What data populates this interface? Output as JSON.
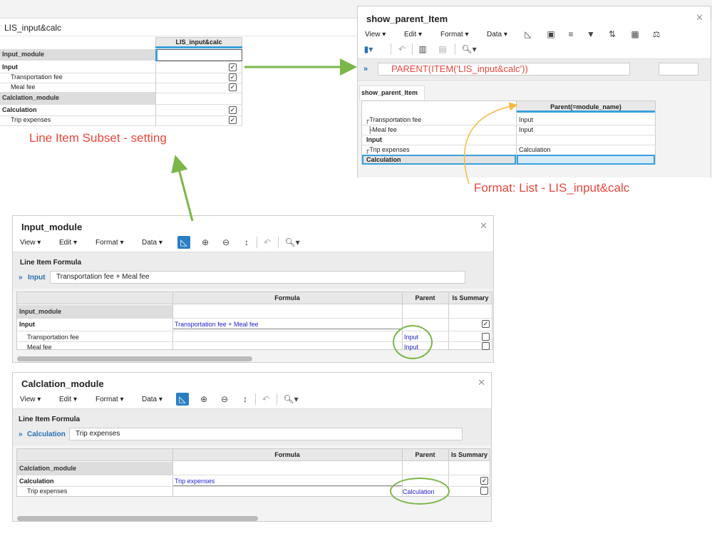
{
  "lis_view": {
    "title": "LIS_input&calc",
    "column_header": "LIS_input&calc",
    "rows": [
      {
        "label": "Input_module"
      },
      {
        "label": "Input"
      },
      {
        "label": "Transportation fee"
      },
      {
        "label": "Meal fee"
      },
      {
        "label": "Calclation_module"
      },
      {
        "label": "Calculation"
      },
      {
        "label": "Trip expenses"
      }
    ]
  },
  "captions": {
    "lis_setting": "Line Item Subset - setting",
    "format_note": "Format: List - LIS_input&calc"
  },
  "show_parent": {
    "title": "show_parent_Item",
    "menus": [
      "View",
      "Edit",
      "Format",
      "Data"
    ],
    "formula": "PARENT(ITEM('LIS_input&calc'))",
    "tab": "show_parent_Item",
    "column_header": "Parent(=module_name)",
    "rows": [
      {
        "label": "Transportation fee",
        "value": "Input"
      },
      {
        "label": "Meal fee",
        "value": "Input"
      },
      {
        "label": "Input",
        "value": ""
      },
      {
        "label": "Trip expenses",
        "value": "Calculation"
      },
      {
        "label": "Calculation",
        "value": ""
      }
    ]
  },
  "input_module": {
    "title": "Input_module",
    "menus": [
      "View",
      "Edit",
      "Format",
      "Data"
    ],
    "formula_label": "Line Item Formula",
    "formula_item": "Input",
    "formula_value": "Transportation fee + Meal fee",
    "headers": [
      "Formula",
      "Parent",
      "Is Summary"
    ],
    "module_row": "Input_module",
    "rows": [
      {
        "label": "Input",
        "formula": "Transportation fee + Meal fee",
        "parent": "",
        "summary": true
      },
      {
        "label": "Transportation fee",
        "formula": "",
        "parent": "Input",
        "summary": false
      },
      {
        "label": "Meal fee",
        "formula": "",
        "parent": "Input",
        "summary": false
      }
    ]
  },
  "calc_module": {
    "title": "Calclation_module",
    "menus": [
      "View",
      "Edit",
      "Format",
      "Data"
    ],
    "formula_label": "Line Item Formula",
    "formula_item": "Calculation",
    "formula_value": "Trip expenses",
    "headers": [
      "Formula",
      "Parent",
      "Is Summary"
    ],
    "module_row": "Calclation_module",
    "rows": [
      {
        "label": "Calculation",
        "formula": "Trip expenses",
        "parent": "",
        "summary": true
      },
      {
        "label": "Trip expenses",
        "formula": "",
        "parent": "Calculation",
        "summary": false
      }
    ]
  },
  "icons": {
    "close": "close-icon",
    "collapse": "chevron-double-down-icon",
    "search": "search-icon"
  },
  "colors": {
    "accent": "#3aa0dc",
    "arrow": "#7ab648",
    "note": "#e8463c",
    "curve": "#f5b942"
  }
}
